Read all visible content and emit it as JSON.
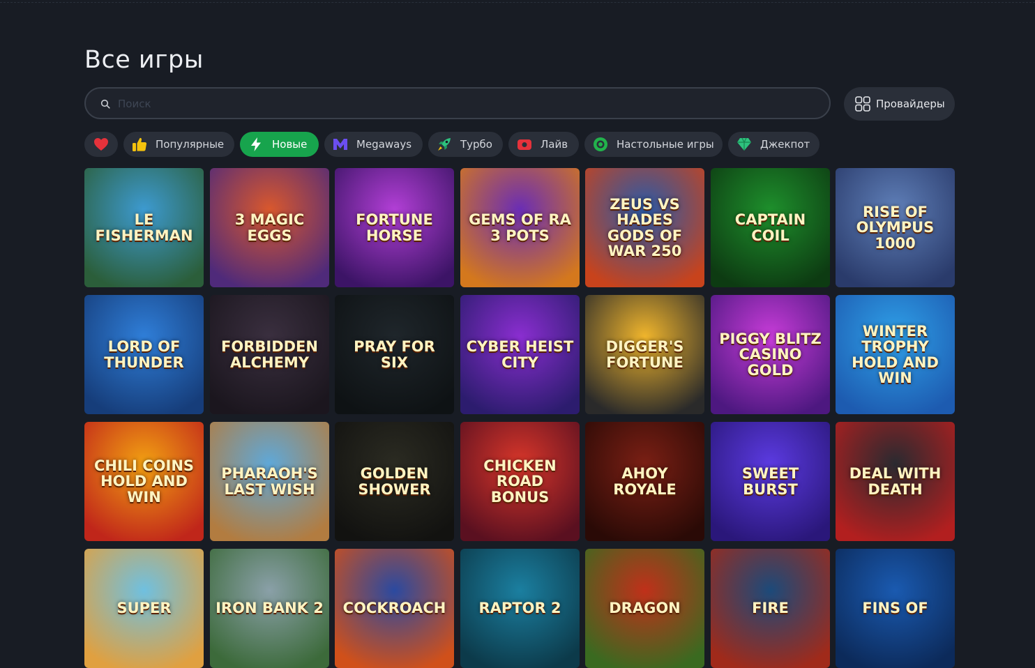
{
  "page": {
    "title": "Все игры"
  },
  "search": {
    "placeholder": "Поиск",
    "value": ""
  },
  "providers_button": {
    "label": "Провайдеры",
    "icon": "grid-icon"
  },
  "filters": [
    {
      "label": "",
      "icon": "heart-icon",
      "color": "#e5323b",
      "active": false
    },
    {
      "label": "Популярные",
      "icon": "thumbs-up-icon",
      "color": "#f4c20d",
      "active": false
    },
    {
      "label": "Новые",
      "icon": "lightning-icon",
      "color": "#ffffff",
      "active": true
    },
    {
      "label": "Megaways",
      "icon": "megaways-icon",
      "color": "#6b4ef0",
      "active": false
    },
    {
      "label": "Турбо",
      "icon": "rocket-icon",
      "color": "#2ec27e",
      "active": false
    },
    {
      "label": "Лайв",
      "icon": "live-camera-icon",
      "color": "#e5323b",
      "active": false
    },
    {
      "label": "Настольные игры",
      "icon": "chip-icon",
      "color": "#22b24c",
      "active": false
    },
    {
      "label": "Джекпот",
      "icon": "diamond-icon",
      "color": "#2ec27e",
      "active": false
    }
  ],
  "accent_color": "#17a44d",
  "games": [
    {
      "title": "Le Fisherman",
      "bg": [
        "#3d9ad0",
        "#2b5e3a"
      ]
    },
    {
      "title": "3 Magic Eggs",
      "bg": [
        "#d9582d",
        "#4f2a7a"
      ]
    },
    {
      "title": "Fortune Horse",
      "bg": [
        "#b23fd6",
        "#3c1466"
      ]
    },
    {
      "title": "Gems of Ra 3 Pots",
      "bg": [
        "#6a2db5",
        "#d4781d"
      ]
    },
    {
      "title": "Zeus vs Hades Gods of War 250",
      "bg": [
        "#2a5aa8",
        "#c8431c"
      ]
    },
    {
      "title": "Captain Coil",
      "bg": [
        "#1e8f2c",
        "#0d3b12"
      ]
    },
    {
      "title": "Rise of Olympus 1000",
      "bg": [
        "#5f7fb8",
        "#2a3b6b"
      ]
    },
    {
      "title": "Lord of Thunder",
      "bg": [
        "#2f7ed8",
        "#163d7a"
      ]
    },
    {
      "title": "Forbidden Alchemy",
      "bg": [
        "#3a2f3f",
        "#1b161e"
      ]
    },
    {
      "title": "Pray for Six",
      "bg": [
        "#1f262b",
        "#0e1214"
      ]
    },
    {
      "title": "Cyber Heist City",
      "bg": [
        "#8a2ed0",
        "#2c1c6e"
      ]
    },
    {
      "title": "Digger's Fortune",
      "bg": [
        "#f0b52c",
        "#2a2a2a"
      ]
    },
    {
      "title": "Piggy Blitz Casino Gold",
      "bg": [
        "#c73cd8",
        "#4d1880"
      ]
    },
    {
      "title": "Winter Trophy Hold and Win",
      "bg": [
        "#2fa0e8",
        "#1d5bb0"
      ]
    },
    {
      "title": "Chili Coins Hold and Win",
      "bg": [
        "#f2a012",
        "#c0261a"
      ]
    },
    {
      "title": "Pharaoh's Last Wish",
      "bg": [
        "#5fa8d8",
        "#b27c40"
      ]
    },
    {
      "title": "Golden Shower",
      "bg": [
        "#2b2b22",
        "#121210"
      ]
    },
    {
      "title": "Chicken Road Bonus",
      "bg": [
        "#d8362a",
        "#5a1020"
      ]
    },
    {
      "title": "Ahoy Royale",
      "bg": [
        "#7a1f14",
        "#2a0a06"
      ]
    },
    {
      "title": "Sweet Burst",
      "bg": [
        "#5b3ae0",
        "#2a177a"
      ]
    },
    {
      "title": "Deal with Death",
      "bg": [
        "#2a2a30",
        "#b21f1f"
      ]
    },
    {
      "title": "Super",
      "bg": [
        "#6fc0e0",
        "#e0a040"
      ]
    },
    {
      "title": "Iron Bank 2",
      "bg": [
        "#8aa0a8",
        "#3c6a3a"
      ]
    },
    {
      "title": "Cockroach",
      "bg": [
        "#2b4aa0",
        "#d0501a"
      ]
    },
    {
      "title": "Raptor 2",
      "bg": [
        "#1b7fa0",
        "#0c3a4a"
      ]
    },
    {
      "title": "Dragon",
      "bg": [
        "#c0301a",
        "#3a6a20"
      ]
    },
    {
      "title": "Fire",
      "bg": [
        "#1c4a7a",
        "#a02a1a"
      ]
    },
    {
      "title": "Fins of",
      "bg": [
        "#1a5ab0",
        "#0c2a5a"
      ]
    }
  ]
}
